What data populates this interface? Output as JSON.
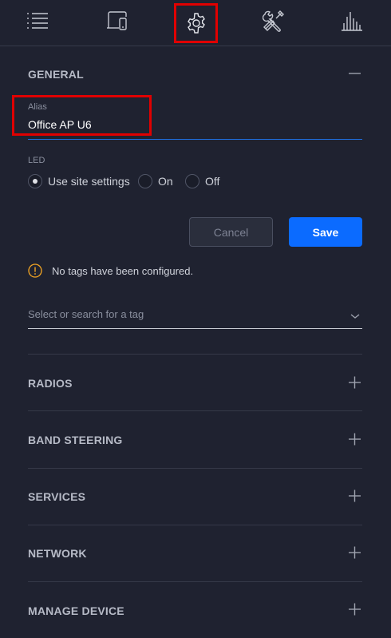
{
  "tabs": [
    {
      "icon": "list-icon"
    },
    {
      "icon": "devices-icon"
    },
    {
      "icon": "gear-icon",
      "highlighted": true
    },
    {
      "icon": "tools-icon"
    },
    {
      "icon": "stats-icon"
    }
  ],
  "general": {
    "title": "GENERAL",
    "alias": {
      "label": "Alias",
      "value": "Office AP U6"
    },
    "led": {
      "label": "LED",
      "options": [
        "Use site settings",
        "On",
        "Off"
      ],
      "selected": "Use site settings"
    },
    "buttons": {
      "cancel": "Cancel",
      "save": "Save"
    },
    "tags_notice": "No tags have been configured.",
    "tag_select_placeholder": "Select or search for a tag"
  },
  "sections": [
    {
      "title": "RADIOS"
    },
    {
      "title": "BAND STEERING"
    },
    {
      "title": "SERVICES"
    },
    {
      "title": "NETWORK"
    },
    {
      "title": "MANAGE DEVICE"
    }
  ],
  "colors": {
    "background": "#1f2230",
    "accent": "#0b6bff",
    "highlight": "#e00000",
    "warning": "#f5a623"
  }
}
